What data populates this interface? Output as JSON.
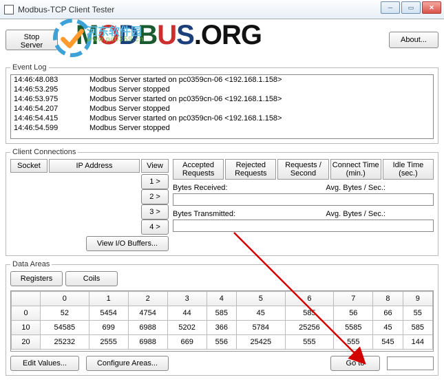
{
  "window": {
    "title": "Modbus-TCP Client Tester"
  },
  "top": {
    "stop_label": "Stop Server",
    "about_label": "About..."
  },
  "logo": {
    "watermark_cn": "河东软件园",
    "watermark_url": "www.pc0359.cn",
    "brand": "MODBUS.ORG"
  },
  "eventlog": {
    "legend": "Event Log",
    "rows": [
      {
        "t": "14:46:48.083",
        "m": "Modbus Server started on pc0359cn-06 <192.168.1.158>"
      },
      {
        "t": "14:46:53.295",
        "m": "Modbus Server stopped"
      },
      {
        "t": "14:46:53.975",
        "m": "Modbus Server started on pc0359cn-06 <192.168.1.158>"
      },
      {
        "t": "14:46:54.207",
        "m": "Modbus Server stopped"
      },
      {
        "t": "14:46:54.415",
        "m": "Modbus Server started on pc0359cn-06 <192.168.1.158>"
      },
      {
        "t": "14:46:54.599",
        "m": "Modbus Server stopped"
      }
    ]
  },
  "cc": {
    "legend": "Client Connections",
    "head": {
      "socket": "Socket",
      "ip": "IP Address",
      "view": "View"
    },
    "viewbtns": [
      "1 >",
      "2 >",
      "3 >",
      "4 >"
    ],
    "viewio_label": "View I/O Buffers...",
    "stats": [
      "Accepted Requests",
      "Rejected Requests",
      "Requests / Second",
      "Connect Time (min.)",
      "Idle Time (sec.)"
    ],
    "bytes_rx": "Bytes Received:",
    "bytes_tx": "Bytes Transmitted:",
    "avg_label": "Avg. Bytes / Sec.:"
  },
  "da": {
    "legend": "Data Areas",
    "tabs": {
      "registers": "Registers",
      "coils": "Coils"
    },
    "cols": [
      "0",
      "1",
      "2",
      "3",
      "4",
      "5",
      "6",
      "7",
      "8",
      "9"
    ],
    "rows": [
      {
        "h": "0",
        "v": [
          "52",
          "5454",
          "4754",
          "44",
          "585",
          "45",
          "585",
          "56",
          "66",
          "55"
        ]
      },
      {
        "h": "10",
        "v": [
          "54585",
          "699",
          "6988",
          "5202",
          "366",
          "5784",
          "25256",
          "5585",
          "45",
          "585"
        ]
      },
      {
        "h": "20",
        "v": [
          "25232",
          "2555",
          "6988",
          "669",
          "556",
          "25425",
          "555",
          "555",
          "545",
          "144"
        ]
      }
    ],
    "edit_label": "Edit Values...",
    "config_label": "Configure Areas...",
    "goto_label": "Go to",
    "goto_value": ""
  }
}
